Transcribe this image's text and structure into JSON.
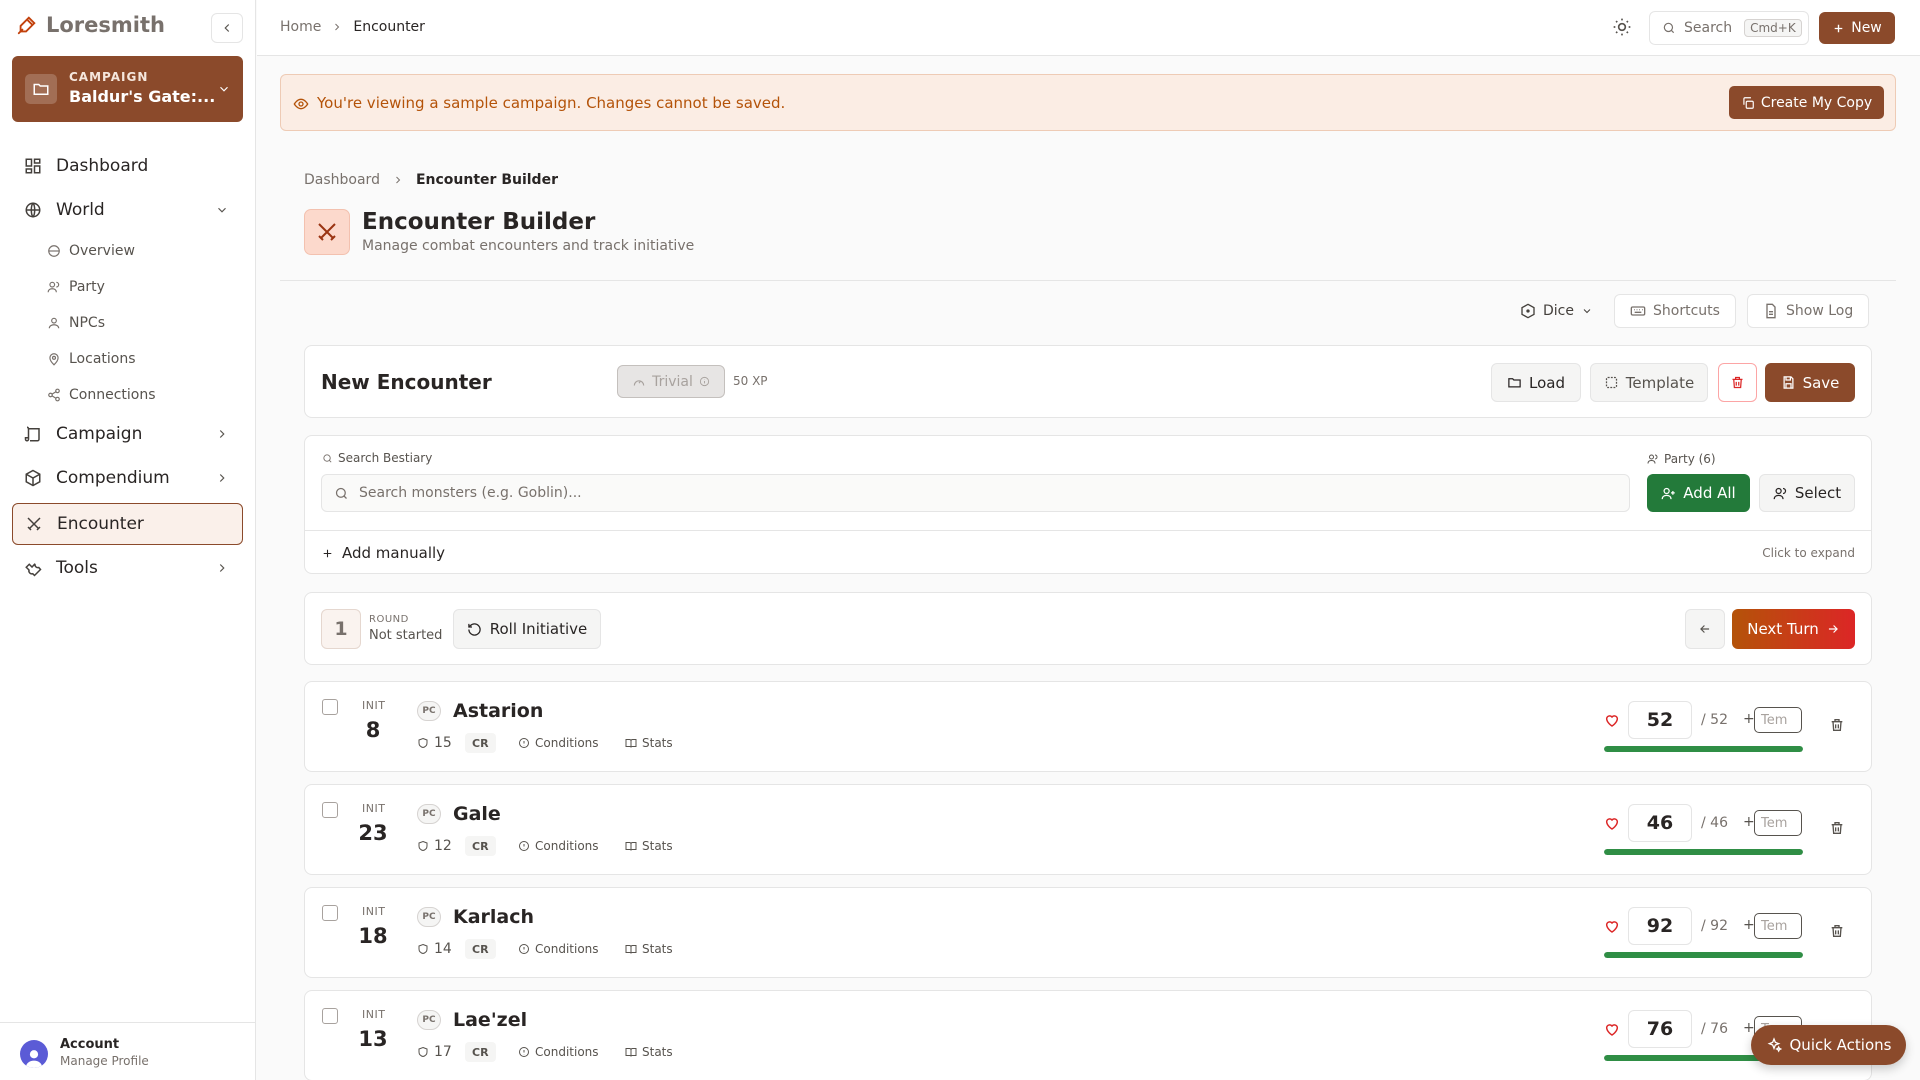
{
  "brand": {
    "name": "Loresmith"
  },
  "campaign": {
    "label": "CAMPAIGN",
    "title": "Baldur's Gate:..."
  },
  "nav": {
    "dashboard": "Dashboard",
    "world": "World",
    "world_sub": [
      "Overview",
      "Party",
      "NPCs",
      "Locations",
      "Connections"
    ],
    "campaign": "Campaign",
    "compendium": "Compendium",
    "encounter": "Encounter",
    "tools": "Tools"
  },
  "account": {
    "name": "Account",
    "sub": "Manage Profile"
  },
  "topbar": {
    "crumb_home": "Home",
    "crumb_current": "Encounter",
    "search_label": "Search",
    "search_kbd": "Cmd+K",
    "new_label": "New"
  },
  "banner": {
    "text": "You're viewing a sample campaign. Changes cannot be saved.",
    "button": "Create My Copy"
  },
  "page": {
    "crumb_dashboard": "Dashboard",
    "crumb_current": "Encounter Builder",
    "title": "Encounter Builder",
    "subtitle": "Manage combat encounters and track initiative"
  },
  "toolbar": {
    "dice": "Dice",
    "shortcuts": "Shortcuts",
    "show_log": "Show Log"
  },
  "encounter": {
    "title": "New Encounter",
    "difficulty": "Trivial",
    "xp": "50 XP",
    "load": "Load",
    "template": "Template",
    "save": "Save"
  },
  "bestiary": {
    "label": "Search Bestiary",
    "placeholder": "Search monsters (e.g. Goblin)...",
    "party_label": "Party (6)",
    "add_all": "Add All",
    "select": "Select",
    "add_manually": "Add manually",
    "expand_hint": "Click to expand"
  },
  "tracker": {
    "round_number": "1",
    "round_label": "ROUND",
    "round_state": "Not started",
    "roll_initiative": "Roll Initiative",
    "next_turn": "Next Turn"
  },
  "combatants": [
    {
      "init_label": "INIT",
      "init": "8",
      "type": "PC",
      "name": "Astarion",
      "ac": "15",
      "cr": "CR",
      "conditions": "Conditions",
      "stats": "Stats",
      "hp": "52",
      "max_hp": "/ 52",
      "temp_plus": "+",
      "temp_placeholder": "Tem",
      "hp_fraction": 1.0
    },
    {
      "init_label": "INIT",
      "init": "23",
      "type": "PC",
      "name": "Gale",
      "ac": "12",
      "cr": "CR",
      "conditions": "Conditions",
      "stats": "Stats",
      "hp": "46",
      "max_hp": "/ 46",
      "temp_plus": "+",
      "temp_placeholder": "Tem",
      "hp_fraction": 1.0
    },
    {
      "init_label": "INIT",
      "init": "18",
      "type": "PC",
      "name": "Karlach",
      "ac": "14",
      "cr": "CR",
      "conditions": "Conditions",
      "stats": "Stats",
      "hp": "92",
      "max_hp": "/ 92",
      "temp_plus": "+",
      "temp_placeholder": "Tem",
      "hp_fraction": 1.0
    },
    {
      "init_label": "INIT",
      "init": "13",
      "type": "PC",
      "name": "Lae'zel",
      "ac": "17",
      "cr": "CR",
      "conditions": "Conditions",
      "stats": "Stats",
      "hp": "76",
      "max_hp": "/ 76",
      "temp_plus": "+",
      "temp_placeholder": "Tem",
      "hp_fraction": 1.0
    }
  ],
  "quick_actions": "Quick Actions",
  "colors": {
    "brand": "#8b4a2b",
    "accent_orange": "#c2410c",
    "success": "#237a3a",
    "hp_bar": "#2f8e45",
    "heart": "#dc2626"
  }
}
